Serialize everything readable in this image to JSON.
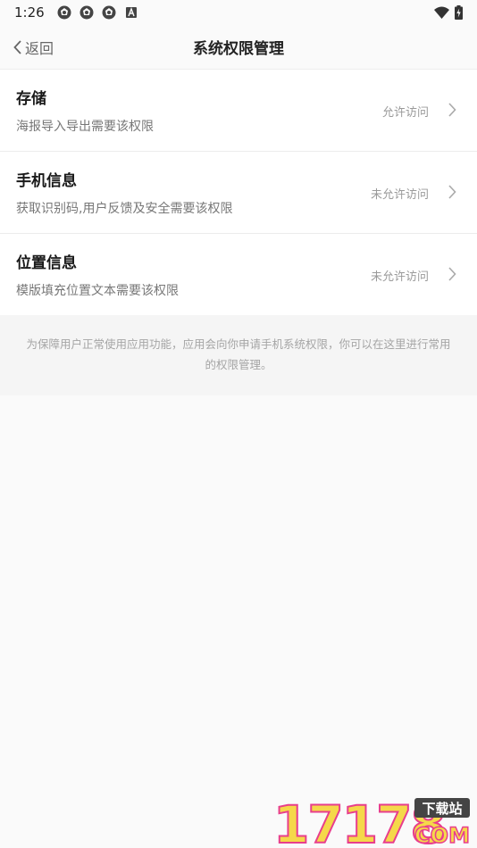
{
  "status_bar": {
    "time": "1:26",
    "left_icons": [
      "aperture-icon",
      "aperture-icon",
      "aperture-icon",
      "a-box-icon"
    ],
    "right_icons": [
      "wifi-icon",
      "battery-charging-icon"
    ]
  },
  "header": {
    "back_label": "返回",
    "title": "系统权限管理"
  },
  "permissions": [
    {
      "title": "存储",
      "description": "海报导入导出需要该权限",
      "status": "允许访问"
    },
    {
      "title": "手机信息",
      "description": "获取识别码,用户反馈及安全需要该权限",
      "status": "未允许访问"
    },
    {
      "title": "位置信息",
      "description": "模版填充位置文本需要该权限",
      "status": "未允许访问"
    }
  ],
  "footer_note": "为保障用户正常使用应用功能，应用会向你申请手机系统权限，你可以在这里进行常用的权限管理。",
  "watermark": {
    "number": "17178",
    "tag": "下载站",
    "suffix": "COM"
  },
  "colors": {
    "background": "#fafafa",
    "card": "#ffffff",
    "watermark_yellow": "#f5d84a",
    "watermark_pink": "#e83e8c"
  }
}
